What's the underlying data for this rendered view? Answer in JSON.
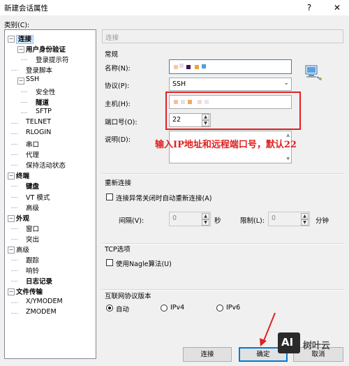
{
  "window": {
    "title": "新建会话属性",
    "help_glyph": "?",
    "close_glyph": "✕"
  },
  "category_label": "类别(C):",
  "tree": [
    {
      "label": "连接",
      "level": 0,
      "bold": true
    },
    {
      "label": "用户身份验证",
      "level": 1,
      "bold": true
    },
    {
      "label": "登录提示符",
      "level": 2,
      "bold": false
    },
    {
      "label": "登录脚本",
      "level": 1,
      "bold": false
    },
    {
      "label": "SSH",
      "level": 1,
      "bold": false
    },
    {
      "label": "安全性",
      "level": 2,
      "bold": false
    },
    {
      "label": "隧道",
      "level": 2,
      "bold": true
    },
    {
      "label": "SFTP",
      "level": 2,
      "bold": false
    },
    {
      "label": "TELNET",
      "level": 1,
      "bold": false
    },
    {
      "label": "RLOGIN",
      "level": 1,
      "bold": false
    },
    {
      "label": "串口",
      "level": 1,
      "bold": false
    },
    {
      "label": "代理",
      "level": 1,
      "bold": false
    },
    {
      "label": "保持活动状态",
      "level": 1,
      "bold": false
    },
    {
      "label": "终端",
      "level": 0,
      "bold": true
    },
    {
      "label": "键盘",
      "level": 1,
      "bold": true
    },
    {
      "label": "VT 模式",
      "level": 1,
      "bold": false
    },
    {
      "label": "高级",
      "level": 1,
      "bold": false
    },
    {
      "label": "外观",
      "level": 0,
      "bold": true
    },
    {
      "label": "窗口",
      "level": 1,
      "bold": false
    },
    {
      "label": "突出",
      "level": 1,
      "bold": false
    },
    {
      "label": "高级",
      "level": 0,
      "bold": false
    },
    {
      "label": "跟踪",
      "level": 1,
      "bold": false
    },
    {
      "label": "响铃",
      "level": 1,
      "bold": false
    },
    {
      "label": "日志记录",
      "level": 1,
      "bold": true
    },
    {
      "label": "文件传输",
      "level": 0,
      "bold": true
    },
    {
      "label": "X/YMODEM",
      "level": 1,
      "bold": false
    },
    {
      "label": "ZMODEM",
      "level": 1,
      "bold": false
    }
  ],
  "panel_header": "连接",
  "general": {
    "heading": "常规",
    "name_label": "名称(N):",
    "protocol_label": "协议(P):",
    "protocol_value": "SSH",
    "host_label": "主机(H):",
    "port_label": "端口号(O):",
    "port_value": "22",
    "desc_label": "说明(D):"
  },
  "annotation": "输入IP地址和远程端口号，默认22",
  "reconnect": {
    "heading": "重新连接",
    "checkbox_label": "连接异常关闭时自动重新连接(A)",
    "interval_label": "间隔(V):",
    "interval_value": "0",
    "interval_unit": "秒",
    "limit_label": "限制(L):",
    "limit_value": "0",
    "limit_unit": "分钟"
  },
  "tcp": {
    "heading": "TCP选项",
    "nagle_label": "使用Nagle算法(U)"
  },
  "ip_version": {
    "heading": "互联网协议版本",
    "options": [
      "自动",
      "IPv4",
      "IPv6"
    ],
    "selected": "自动"
  },
  "buttons": {
    "connect": "连接",
    "ok": "确定",
    "cancel": "取消"
  },
  "watermark": {
    "logo_text": "AI",
    "brand": "树叶云"
  },
  "colors": {
    "annotation_red": "#e02020",
    "selection_blue": "#cce8ff",
    "focus_blue": "#0078d7"
  }
}
